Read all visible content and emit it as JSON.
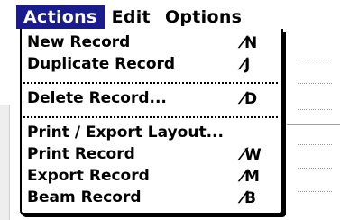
{
  "menubar": {
    "items": [
      {
        "label": "Actions",
        "active": true
      },
      {
        "label": "Edit",
        "active": false
      },
      {
        "label": "Options",
        "active": false
      }
    ]
  },
  "menu": {
    "shortcut_glyph": "stroke-icon",
    "items": [
      {
        "label": "New Record",
        "shortcut": "N"
      },
      {
        "label": "Duplicate Record",
        "shortcut": "J"
      },
      {
        "label": "Delete Record...",
        "shortcut": "D"
      },
      {
        "label": "Print / Export Layout...",
        "shortcut": ""
      },
      {
        "label": "Print Record",
        "shortcut": "W"
      },
      {
        "label": "Export Record",
        "shortcut": "M"
      },
      {
        "label": "Beam Record",
        "shortcut": "B"
      }
    ]
  },
  "colors": {
    "menu_highlight": "#1b1c8c",
    "text": "#000000",
    "background": "#ffffff"
  }
}
